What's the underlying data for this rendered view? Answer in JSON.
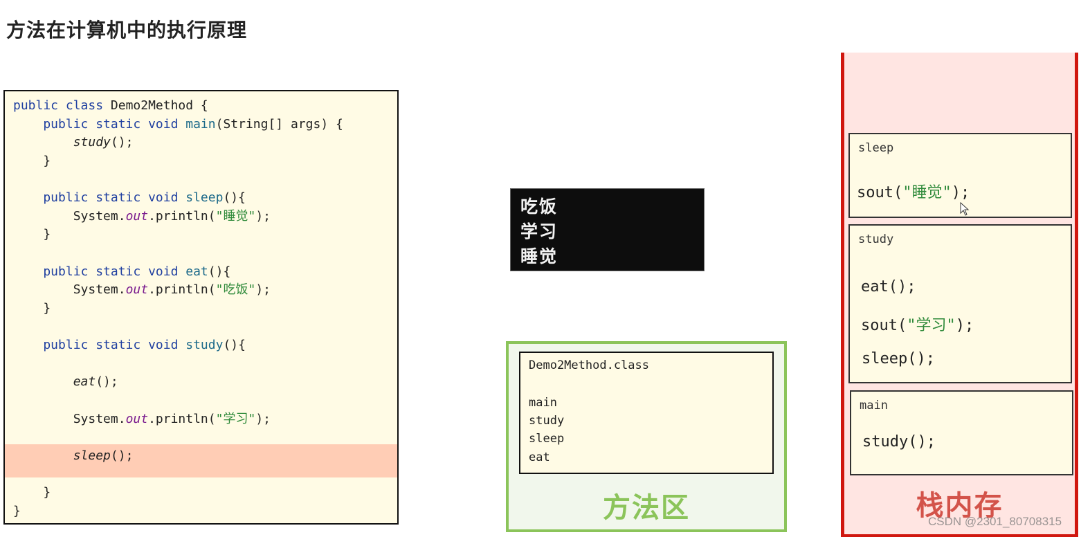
{
  "title": "方法在计算机中的执行原理",
  "code": {
    "lines": [
      {
        "parts": [
          {
            "t": "public class ",
            "c": "kw"
          },
          {
            "t": "Demo2Method {",
            "c": ""
          }
        ]
      },
      {
        "parts": [
          {
            "t": "    public static void ",
            "c": "kw"
          },
          {
            "t": "main",
            "c": "fn"
          },
          {
            "t": "(String[] args) {",
            "c": ""
          }
        ]
      },
      {
        "parts": [
          {
            "t": "        ",
            "c": ""
          },
          {
            "t": "study",
            "c": "it"
          },
          {
            "t": "();",
            "c": ""
          }
        ]
      },
      {
        "parts": [
          {
            "t": "    }",
            "c": ""
          }
        ]
      },
      {
        "parts": []
      },
      {
        "parts": [
          {
            "t": "    public static void ",
            "c": "kw"
          },
          {
            "t": "sleep",
            "c": "fn"
          },
          {
            "t": "(){",
            "c": ""
          }
        ]
      },
      {
        "parts": [
          {
            "t": "        System.",
            "c": ""
          },
          {
            "t": "out",
            "c": "field"
          },
          {
            "t": ".println(",
            "c": ""
          },
          {
            "t": "\"睡觉\"",
            "c": "str"
          },
          {
            "t": ");",
            "c": ""
          }
        ]
      },
      {
        "parts": [
          {
            "t": "    }",
            "c": ""
          }
        ]
      },
      {
        "parts": []
      },
      {
        "parts": [
          {
            "t": "    public static void ",
            "c": "kw"
          },
          {
            "t": "eat",
            "c": "fn"
          },
          {
            "t": "(){",
            "c": ""
          }
        ]
      },
      {
        "parts": [
          {
            "t": "        System.",
            "c": ""
          },
          {
            "t": "out",
            "c": "field"
          },
          {
            "t": ".println(",
            "c": ""
          },
          {
            "t": "\"吃饭\"",
            "c": "str"
          },
          {
            "t": ");",
            "c": ""
          }
        ]
      },
      {
        "parts": [
          {
            "t": "    }",
            "c": ""
          }
        ]
      },
      {
        "parts": []
      },
      {
        "parts": [
          {
            "t": "    public static void ",
            "c": "kw"
          },
          {
            "t": "study",
            "c": "fn"
          },
          {
            "t": "(){",
            "c": ""
          }
        ]
      },
      {
        "parts": []
      },
      {
        "parts": [
          {
            "t": "        ",
            "c": ""
          },
          {
            "t": "eat",
            "c": "it"
          },
          {
            "t": "();",
            "c": ""
          }
        ]
      },
      {
        "parts": []
      },
      {
        "parts": [
          {
            "t": "        System.",
            "c": ""
          },
          {
            "t": "out",
            "c": "field"
          },
          {
            "t": ".println(",
            "c": ""
          },
          {
            "t": "\"学习\"",
            "c": "str"
          },
          {
            "t": ");",
            "c": ""
          }
        ]
      },
      {
        "parts": []
      },
      {
        "parts": [
          {
            "t": "        ",
            "c": ""
          },
          {
            "t": "sleep",
            "c": "it"
          },
          {
            "t": "();",
            "c": ""
          }
        ]
      },
      {
        "parts": []
      },
      {
        "parts": [
          {
            "t": "    }",
            "c": ""
          }
        ]
      },
      {
        "parts": [
          {
            "t": "}",
            "c": ""
          }
        ]
      }
    ],
    "highlighted_line": "sleep();"
  },
  "console": {
    "lines": [
      "吃饭",
      "学习",
      "睡觉"
    ]
  },
  "method_area": {
    "class_name": "Demo2Method.class",
    "methods": [
      "main",
      "study",
      "sleep",
      "eat"
    ],
    "label": "方法区",
    "color": "#8bc45a"
  },
  "stack": {
    "label": "栈内存",
    "color": "#d0170f",
    "frames": [
      {
        "name": "sleep",
        "statements": [
          "sout(\"睡觉\");"
        ]
      },
      {
        "name": "study",
        "statements": [
          "eat();",
          "sout(\"学习\");",
          "sleep();"
        ]
      },
      {
        "name": "main",
        "statements": [
          "study();"
        ]
      }
    ]
  },
  "watermark": "CSDN @2301_80708315"
}
